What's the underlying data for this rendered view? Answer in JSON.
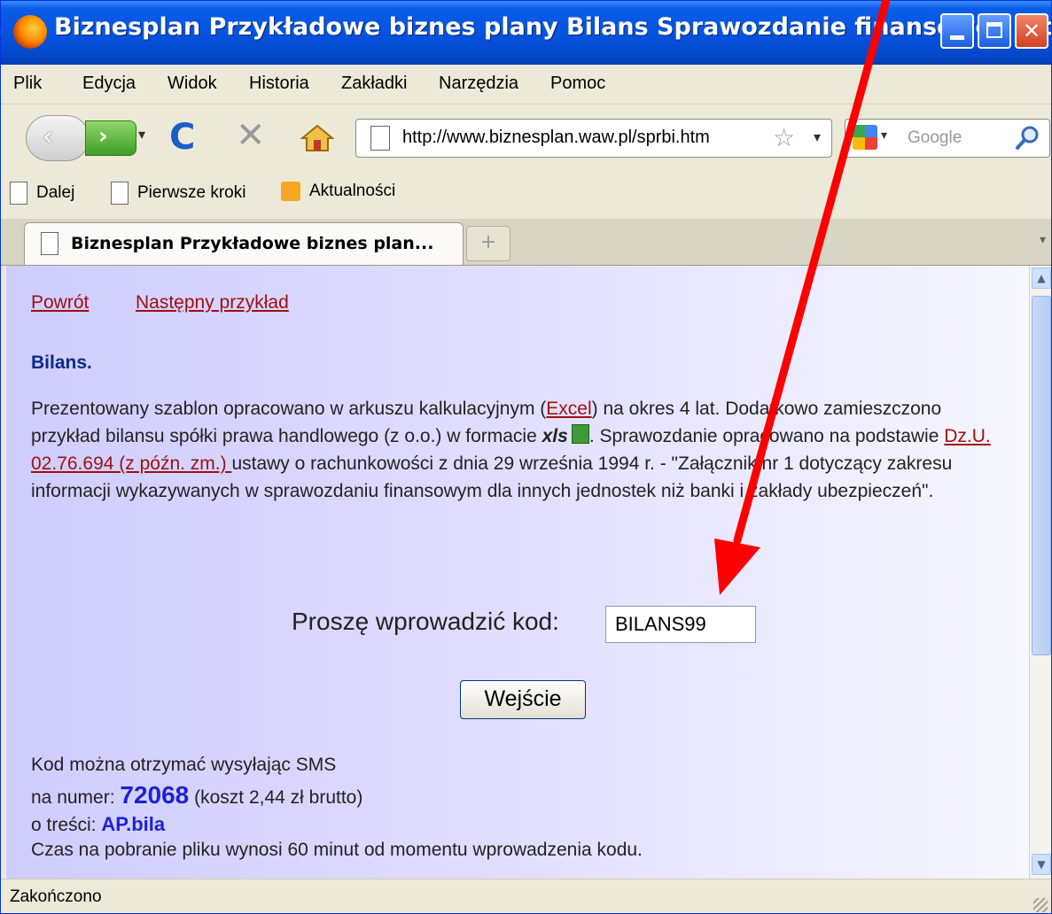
{
  "window": {
    "title": "Biznesplan Przykładowe biznes plany Bilans Sprawozdanie finansowe - Mozill...",
    "controls": {
      "minimize": "_",
      "maximize": "□",
      "close": "✕"
    }
  },
  "menu": [
    "Plik",
    "Edycja",
    "Widok",
    "Historia",
    "Zakładki",
    "Narzędzia",
    "Pomoc"
  ],
  "nav": {
    "back": "‹",
    "forward": "›",
    "url": "http://www.biznesplan.waw.pl/sprbi.htm",
    "search_placeholder": "Google"
  },
  "bookmarks": [
    "Dalej",
    "Pierwsze kroki",
    "Aktualności"
  ],
  "tab": {
    "label": "Biznesplan Przykładowe biznes plan...",
    "new_tab": "+"
  },
  "content": {
    "link_back": "Powrót",
    "link_next": "Następny przykład",
    "heading": "Bilans.",
    "para": {
      "p1": "Prezentowany szablon opracowano w arkuszu kalkulacyjnym (",
      "excel": "Excel",
      "p2": ") na okres 4 lat. Dodatkowo zamieszczono przykład bilansu spółki prawa handlowego (z o.o.) w formacie ",
      "xls": "xls",
      "p3": ". Sprawozdanie opracowano na podstawie ",
      "law": "Dz.U. 02.76.694 (z późn. zm.) ",
      "p4": "ustawy o rachunkowości z dnia 29 września 1994 r. - \"Załącznik nr 1 dotyczący zakresu informacji wykazywanych w sprawozdaniu finansowym dla innych jednostek niż banki i zakłady ubezpieczeń\"."
    },
    "code_label": "Proszę  wprowadzić kod:",
    "code_value": "BILANS99",
    "submit": "Wejście",
    "sms1": "Kod można otrzymać wysyłając SMS",
    "sms2_pre": "na numer: ",
    "sms_number": "72068",
    "sms2_post": " (koszt 2,44 zł brutto)",
    "sms3_pre": "o treści:  ",
    "sms_text": "AP.bila",
    "sms4": "Czas na pobranie pliku wynosi 60 minut od momentu wprowadzenia kodu."
  },
  "status": "Zakończono",
  "colors": {
    "annotation_arrow": "#ff0000",
    "link": "#a01010",
    "accent_number": "#1d22d6"
  }
}
